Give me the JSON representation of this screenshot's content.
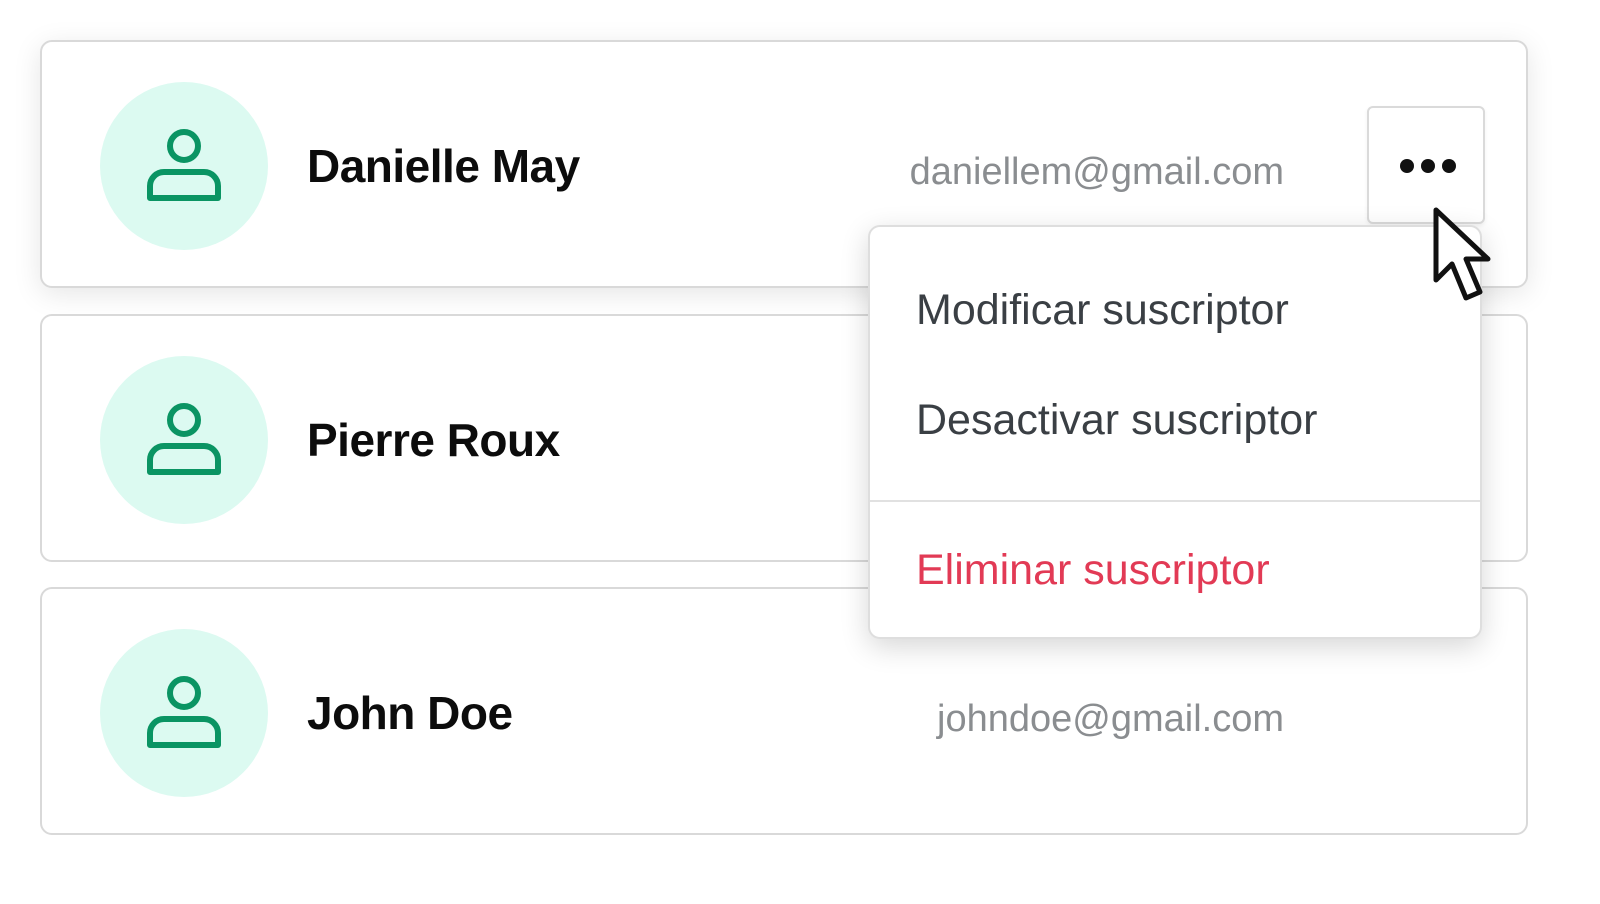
{
  "subscribers": [
    {
      "name": "Danielle May",
      "email": "daniellem@gmail.com"
    },
    {
      "name": "Pierre Roux",
      "email": ""
    },
    {
      "name": "John Doe",
      "email": "johndoe@gmail.com"
    }
  ],
  "actions_menu": {
    "items": [
      {
        "label": "Modificar suscriptor"
      },
      {
        "label": "Desactivar suscriptor"
      },
      {
        "label": "Eliminar suscriptor"
      }
    ]
  },
  "icons": {
    "avatar": "user-icon",
    "more": "more-horizontal-icon",
    "cursor": "mouse-pointer-icon"
  },
  "colors": {
    "avatar_bg": "#dcfaf1",
    "avatar_icon": "#0a9463",
    "danger": "#e23a55",
    "email": "#8a8d90"
  }
}
